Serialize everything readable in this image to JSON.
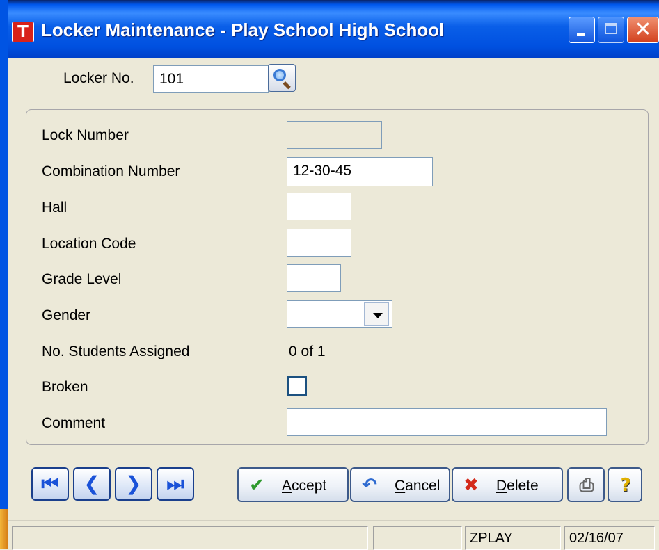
{
  "window": {
    "title": "Locker Maintenance - Play School High School",
    "icon_letter": "T"
  },
  "header": {
    "locker_no_label": "Locker No.",
    "locker_no_value": "101",
    "lookup_icon": "magnifier-icon"
  },
  "form": {
    "lock_number_label": "Lock Number",
    "lock_number_value": "",
    "combination_label": "Combination Number",
    "combination_value": "12-30-45",
    "hall_label": "Hall",
    "hall_value": "",
    "location_code_label": "Location Code",
    "location_code_value": "",
    "grade_level_label": "Grade Level",
    "grade_level_value": "",
    "gender_label": "Gender",
    "gender_value": "",
    "students_assigned_label": "No. Students Assigned",
    "students_assigned_value": "0 of 1",
    "broken_label": "Broken",
    "broken_checked": false,
    "comment_label": "Comment",
    "comment_value": ""
  },
  "nav": {
    "first_icon": "first-record-icon",
    "prev_icon": "previous-record-icon",
    "next_icon": "next-record-icon",
    "last_icon": "last-record-icon"
  },
  "actions": {
    "accept_label": "Accept",
    "cancel_label": "Cancel",
    "delete_label": "Delete",
    "print_icon": "printer-icon",
    "help_icon": "help-icon"
  },
  "statusbar": {
    "panel1": "",
    "panel2": "",
    "user": "ZPLAY",
    "date": "02/16/07"
  },
  "colors": {
    "titlebar": "#0058ee",
    "accept_check": "#2e9a2e",
    "delete_x": "#d42a1a",
    "nav_arrow": "#1a52d8"
  }
}
